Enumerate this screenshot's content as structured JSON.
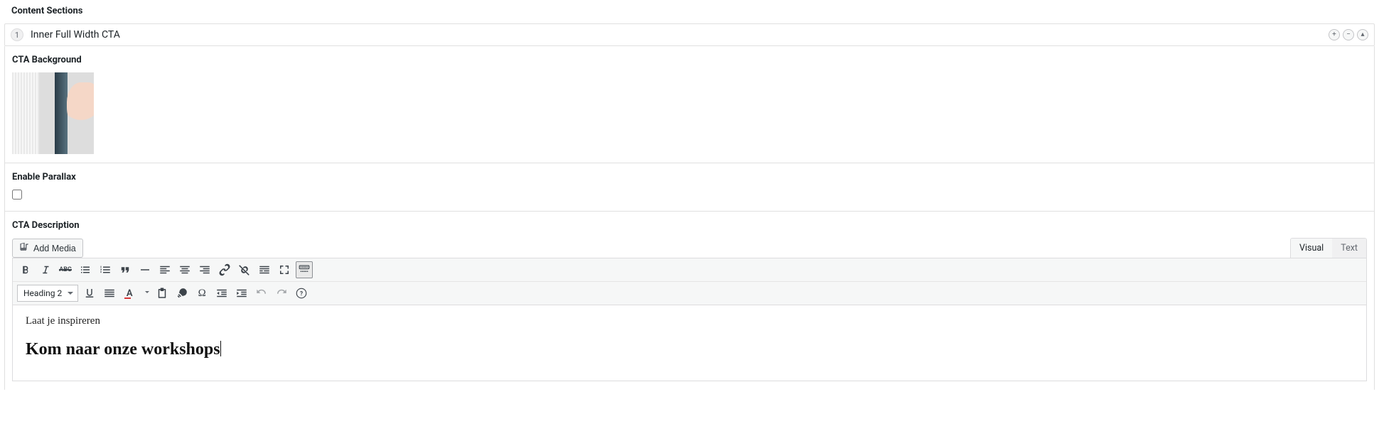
{
  "section_title": "Content Sections",
  "layout": {
    "index": "1",
    "name": "Inner Full Width CTA"
  },
  "fields": {
    "cta_background": {
      "label": "CTA Background"
    },
    "enable_parallax": {
      "label": "Enable Parallax",
      "checked": false
    },
    "cta_description": {
      "label": "CTA Description"
    }
  },
  "editor": {
    "add_media": "Add Media",
    "tabs": {
      "visual": "Visual",
      "text": "Text"
    },
    "format_select": "Heading 2",
    "content": {
      "line1": "Laat je inspireren",
      "heading": "Kom naar onze workshops"
    }
  }
}
